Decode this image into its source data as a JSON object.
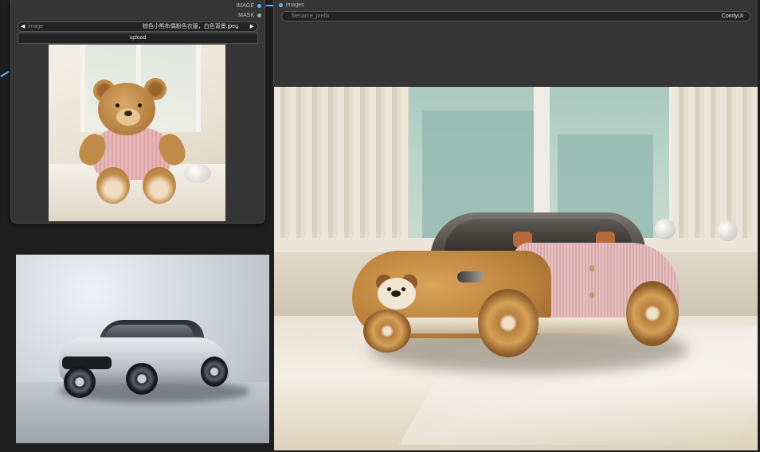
{
  "load_node": {
    "outputs": [
      {
        "label": "IMAGE",
        "color": "#64b5f6"
      },
      {
        "label": "MASK",
        "color": "#81c784"
      }
    ],
    "image_widget": {
      "label": "image",
      "value": "棕色小熊布偶粉色衣服，白色背景.jpeg",
      "prev_icon": "◀",
      "next_icon": "▶"
    },
    "upload_label": "upload"
  },
  "save_node": {
    "input_label": "images",
    "filename_widget": {
      "label": "filename_prefix",
      "value": "ComfyUI"
    }
  },
  "colors": {
    "canvas": "#1e1e1e",
    "node_bg": "#353535",
    "image_link": "#64b5f6",
    "mask_link": "#81c784"
  }
}
